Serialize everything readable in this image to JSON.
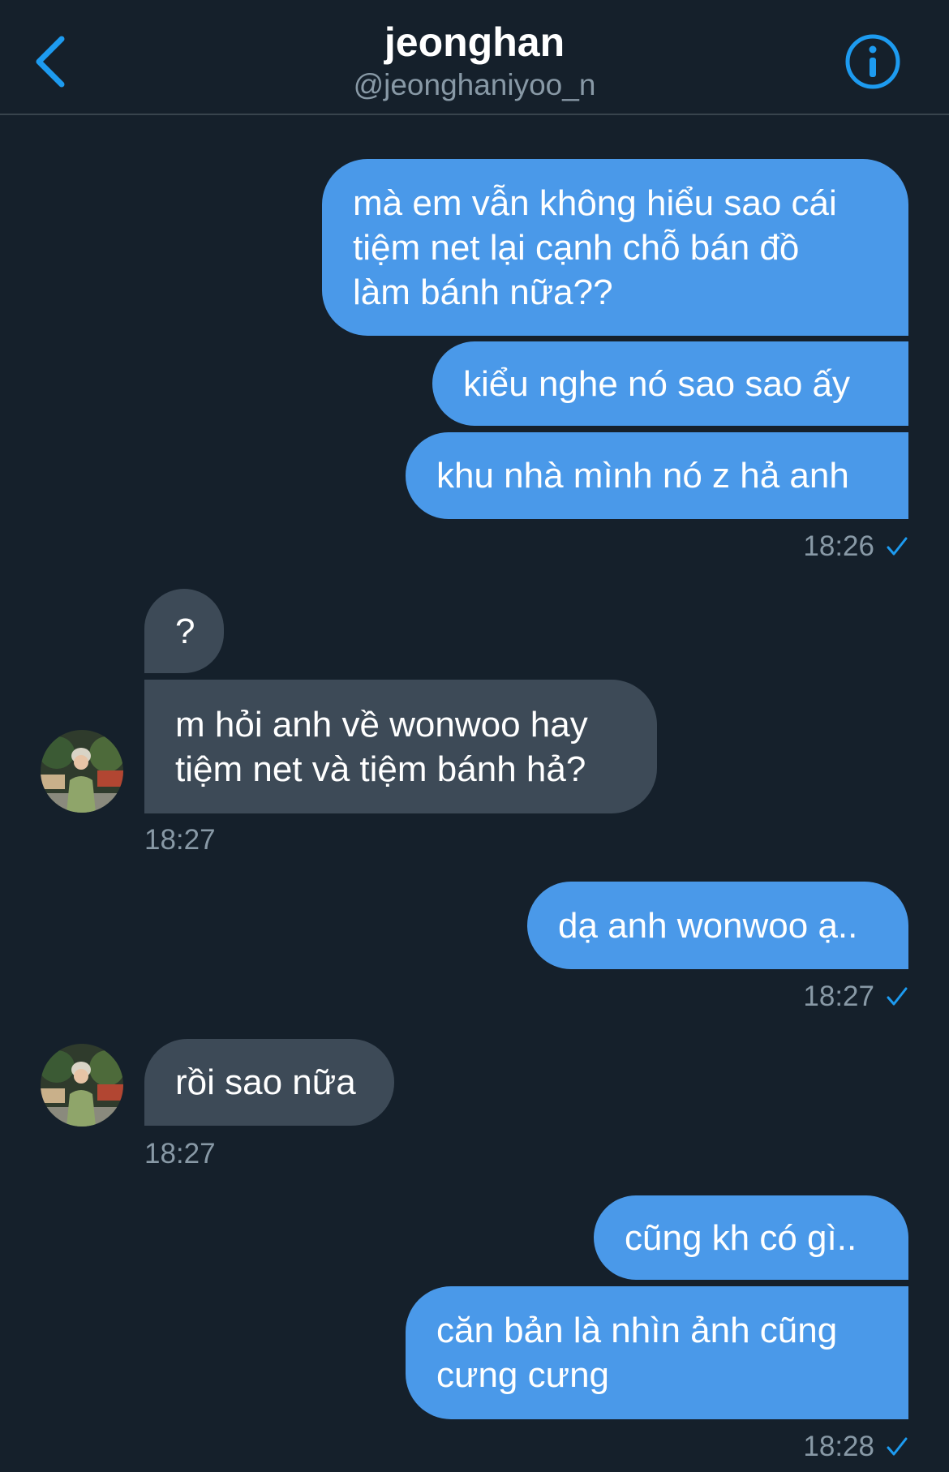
{
  "header": {
    "title": "jeonghan",
    "handle": "@jeonghaniyoo_n"
  },
  "colors": {
    "background": "#15202b",
    "sent_bubble": "#4a99e9",
    "received_bubble": "#3d4a57",
    "accent": "#1d9bf0",
    "muted_text": "#8899a6"
  },
  "icons": {
    "back": "chevron-left-icon",
    "info": "info-circle-icon",
    "read_receipt": "check-icon"
  },
  "messages": [
    {
      "from": "me",
      "text": "mà em vẫn không hiểu sao cái\ntiệm net lại cạnh chỗ bán đồ\nlàm bánh nữa??"
    },
    {
      "from": "me",
      "text": "kiểu nghe nó sao sao ấy"
    },
    {
      "from": "me",
      "text": "khu nhà mình nó z hả anh"
    },
    {
      "from": "them",
      "text": "?"
    },
    {
      "from": "them",
      "text": "m hỏi anh về wonwoo hay\ntiệm net và tiệm bánh hả?"
    },
    {
      "from": "me",
      "text": "dạ anh wonwoo ạ.."
    },
    {
      "from": "them",
      "text": "rồi sao nữa"
    },
    {
      "from": "me",
      "text": "cũng kh có gì.."
    },
    {
      "from": "me",
      "text": "căn bản là nhìn ảnh cũng\ncưng cưng"
    }
  ],
  "timestamps": {
    "t1": "18:26",
    "t2": "18:27",
    "t3": "18:27",
    "t4": "18:27",
    "t5": "18:28"
  }
}
